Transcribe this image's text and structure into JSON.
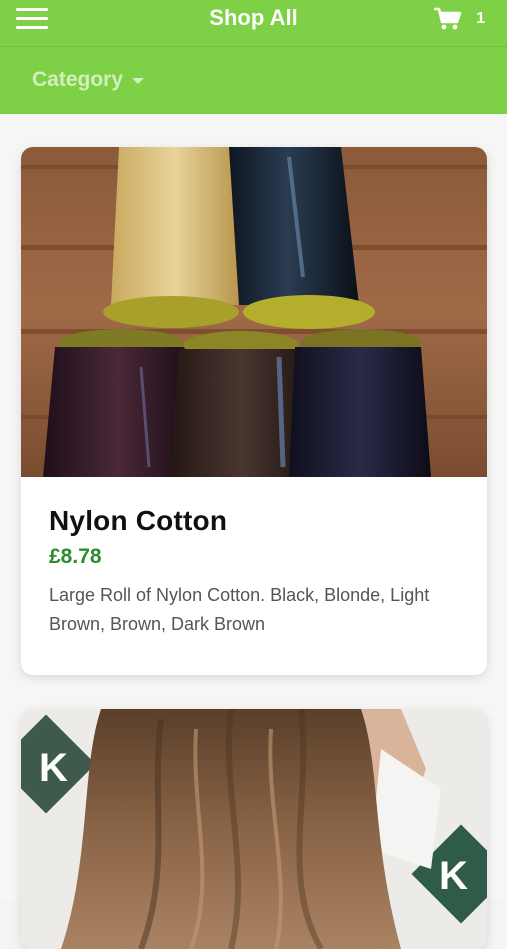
{
  "header": {
    "title": "Shop All",
    "cart_count": "1",
    "category_label": "Category",
    "accent_color": "#7ed047",
    "icons": [
      "menu-icon",
      "cart-icon",
      "caret-down-icon"
    ]
  },
  "products": [
    {
      "name": "Nylon Cotton",
      "price": "£8.78",
      "description": "Large Roll of Nylon Cotton.  Black, Blonde, Light Brown, Brown, Dark Brown",
      "image": "thread-spools-photo"
    },
    {
      "image": "hair-extensions-photo"
    }
  ]
}
